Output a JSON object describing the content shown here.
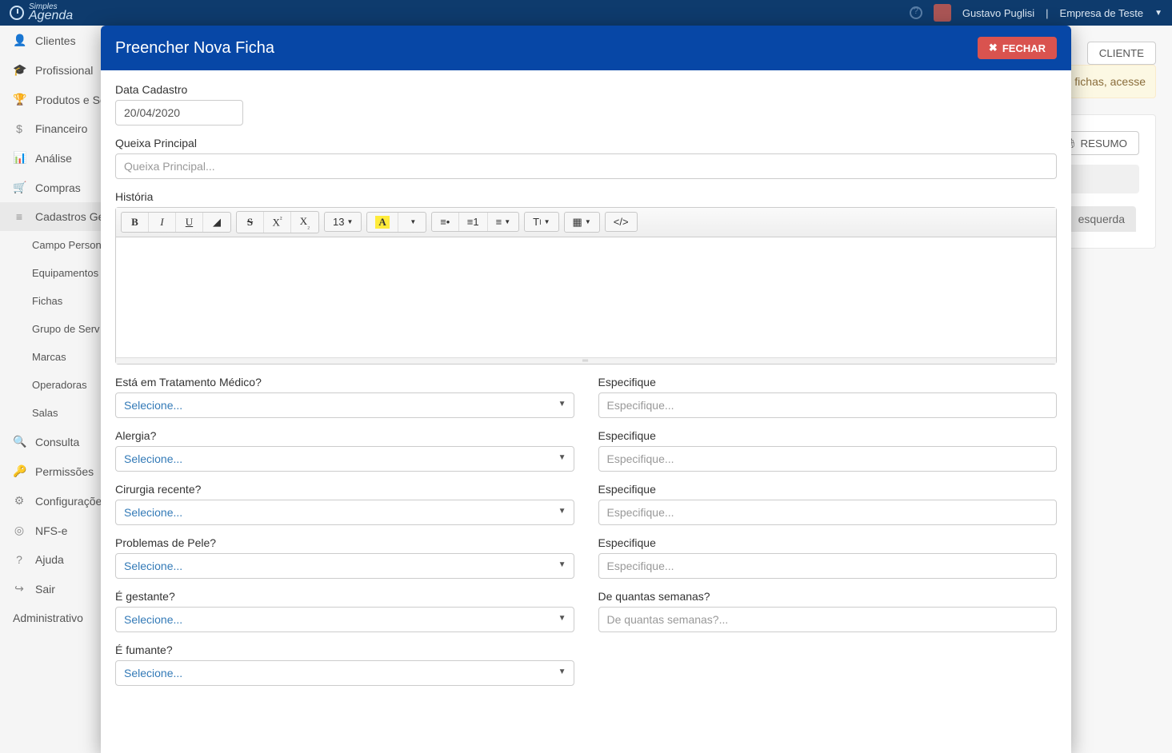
{
  "brand": {
    "top": "Simples",
    "bottom": "Agenda"
  },
  "user": {
    "name": "Gustavo Puglisi",
    "company": "Empresa de Teste"
  },
  "sidebar": {
    "items": [
      {
        "icon": "👤",
        "label": "Clientes"
      },
      {
        "icon": "🎓",
        "label": "Profissional"
      },
      {
        "icon": "🏆",
        "label": "Produtos e Se"
      },
      {
        "icon": "$",
        "label": "Financeiro"
      },
      {
        "icon": "📊",
        "label": "Análise"
      },
      {
        "icon": "🛒",
        "label": "Compras"
      },
      {
        "icon": "≡",
        "label": "Cadastros Ger"
      }
    ],
    "subitems": [
      "Campo Person",
      "Equipamentos",
      "Fichas",
      "Grupo de Serv",
      "Marcas",
      "Operadoras",
      "Salas"
    ],
    "items2": [
      {
        "icon": "🔍",
        "label": "Consulta"
      },
      {
        "icon": "🔑",
        "label": "Permissões"
      },
      {
        "icon": "⚙",
        "label": "Configurações"
      },
      {
        "icon": "◎",
        "label": "NFS-e"
      },
      {
        "icon": "?",
        "label": "Ajuda"
      },
      {
        "icon": "↪",
        "label": "Sair"
      }
    ],
    "admin": "Administrativo"
  },
  "bg": {
    "alert_tail": "as fichas, acesse",
    "btn_cliente": "CLIENTE",
    "btn_resumo": "RESUMO",
    "tab": "esquerda"
  },
  "modal": {
    "title": "Preencher Nova Ficha",
    "close": "FECHAR",
    "data_cadastro_label": "Data Cadastro",
    "data_cadastro_value": "20/04/2020",
    "queixa_label": "Queixa Principal",
    "queixa_placeholder": "Queixa Principal...",
    "historia_label": "História",
    "fontsize": "13",
    "tratamento_label": "Está em Tratamento Médico?",
    "especifique_label": "Especifique",
    "especifique_placeholder": "Especifique...",
    "alergia_label": "Alergia?",
    "cirurgia_label": "Cirurgia recente?",
    "pele_label": "Problemas de Pele?",
    "gestante_label": "É gestante?",
    "semanas_label": "De quantas semanas?",
    "semanas_placeholder": "De quantas semanas?...",
    "fumante_label": "É fumante?",
    "selecione": "Selecione..."
  }
}
